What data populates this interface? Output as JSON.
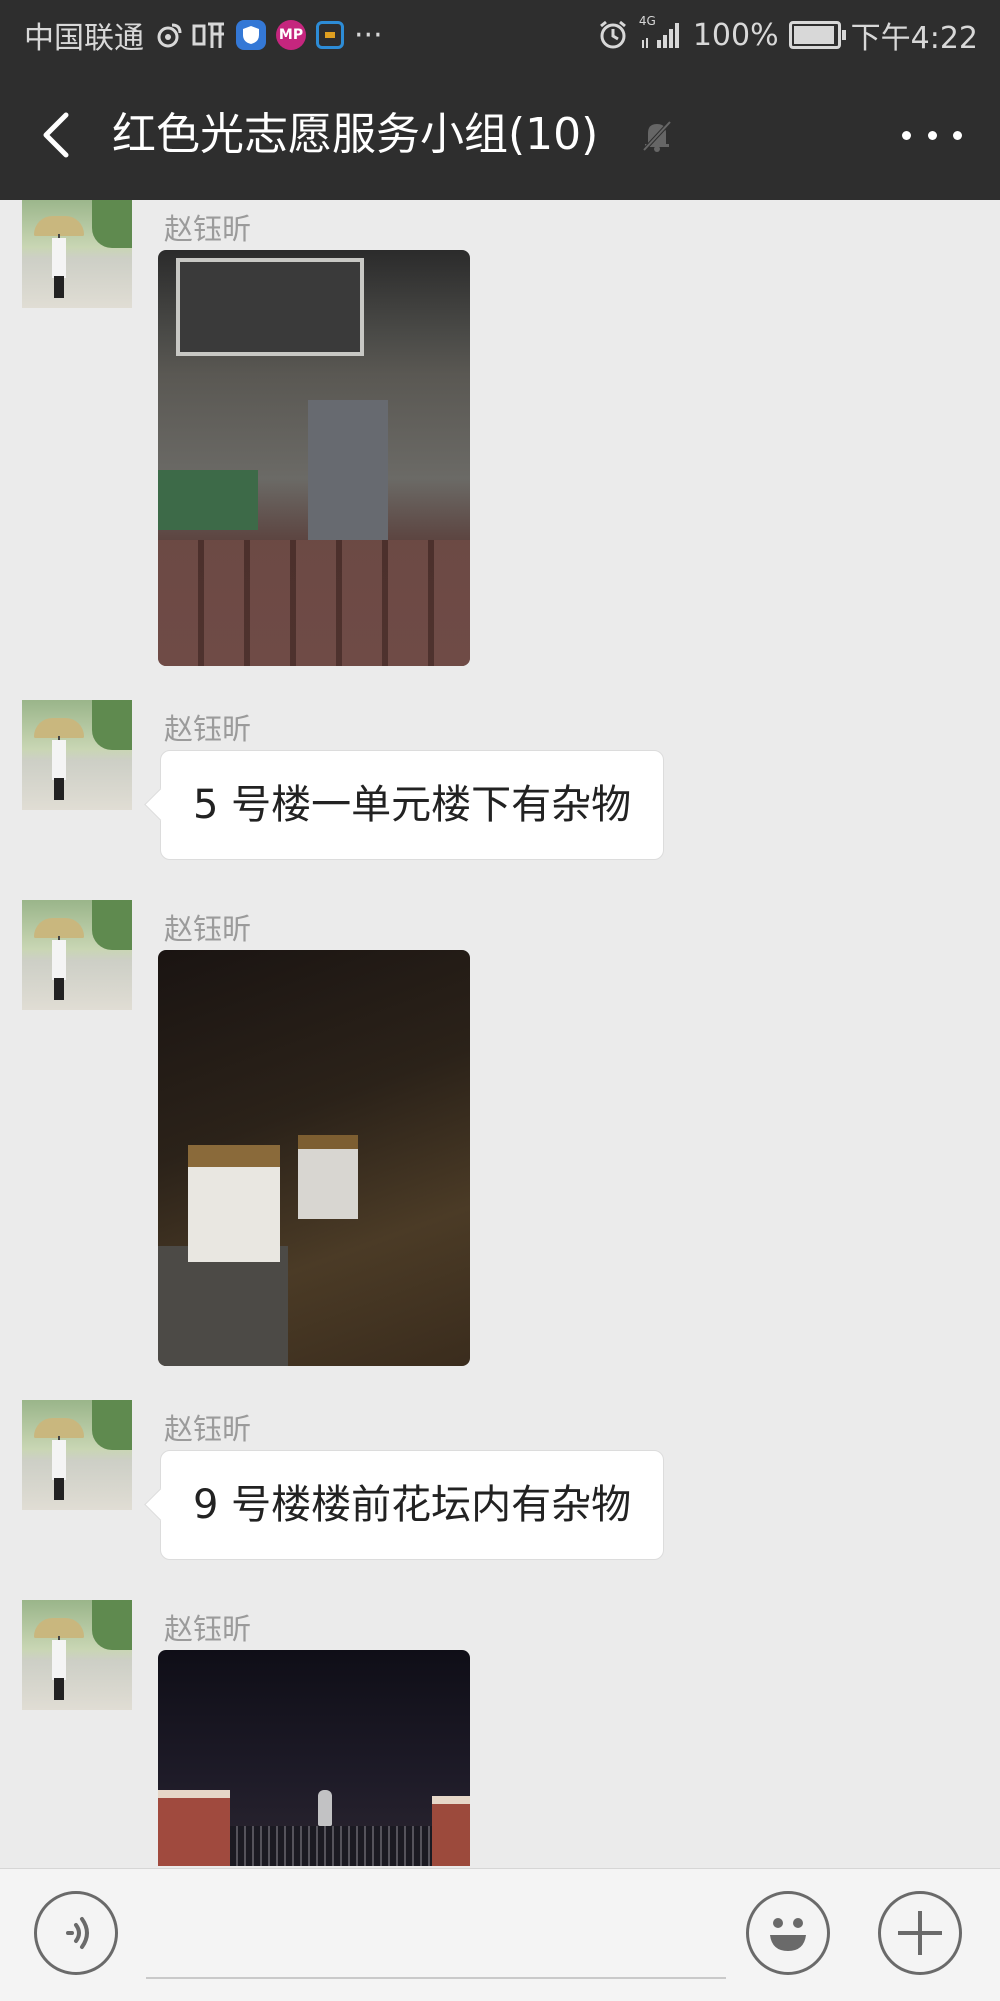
{
  "status_bar": {
    "carrier": "中国联通",
    "app_icons": [
      "weibo-icon",
      "ting-icon",
      "shield-icon",
      "mp-icon",
      "notification-icon"
    ],
    "more": "···",
    "alarm_icon": "alarm-icon",
    "network": "4G",
    "battery_percent": "100%",
    "battery_level": 1.0,
    "time": "下午4:22"
  },
  "header": {
    "back_icon": "chevron-left-icon",
    "title": "红色光志愿服务小组(10)",
    "mute_icon": "bell-off-icon",
    "more_icon": "more-dots-icon"
  },
  "messages": [
    {
      "type": "image",
      "sender": "赵钰昕",
      "image_desc": "night-courtyard-sink"
    },
    {
      "type": "text",
      "sender": "赵钰昕",
      "text": "5 号楼一单元楼下有杂物"
    },
    {
      "type": "image",
      "sender": "赵钰昕",
      "image_desc": "foam-boxes-leaves"
    },
    {
      "type": "text",
      "sender": "赵钰昕",
      "text": "9 号楼楼前花坛内有杂物"
    },
    {
      "type": "image",
      "sender": "赵钰昕",
      "image_desc": "night-gate"
    }
  ],
  "input_bar": {
    "voice_icon": "voice-icon",
    "input_value": "",
    "emoji_icon": "smile-icon",
    "plus_icon": "plus-icon"
  },
  "colors": {
    "bar_background": "#2e2e2e",
    "chat_background": "#ebebeb",
    "sender_text": "#9b9b9b"
  }
}
